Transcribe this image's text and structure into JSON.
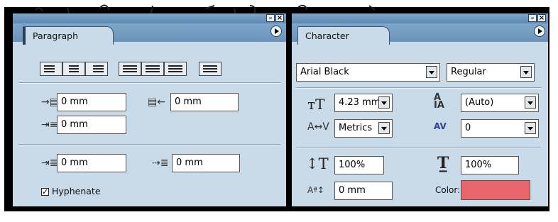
{
  "colors": {
    "palette_bg": "#c9dbe8",
    "title_bar": "#6b93bb",
    "swatch": "#e8666b"
  },
  "paragraph": {
    "tab_label": "Paragraph",
    "left_indent": "0 mm",
    "right_indent": "0 mm",
    "first_line_indent": "0 mm",
    "space_before": "0 mm",
    "space_after": "0 mm",
    "hyphenate_label": "Hyphenate",
    "hyphenate_checked": "✓",
    "align_icons": [
      "align-left-icon",
      "align-center-icon",
      "align-right-icon",
      "justify-left-icon",
      "justify-center-icon",
      "justify-right-icon",
      "justify-all-icon"
    ]
  },
  "character": {
    "tab_label": "Character",
    "font_family": "Arial Black",
    "font_style": "Regular",
    "font_size": "4.23 mm",
    "leading": "(Auto)",
    "kerning": "Metrics",
    "tracking": "0",
    "vertical_scale": "100%",
    "horizontal_scale": "100%",
    "baseline_shift": "0 mm",
    "color_label": "Color:"
  }
}
